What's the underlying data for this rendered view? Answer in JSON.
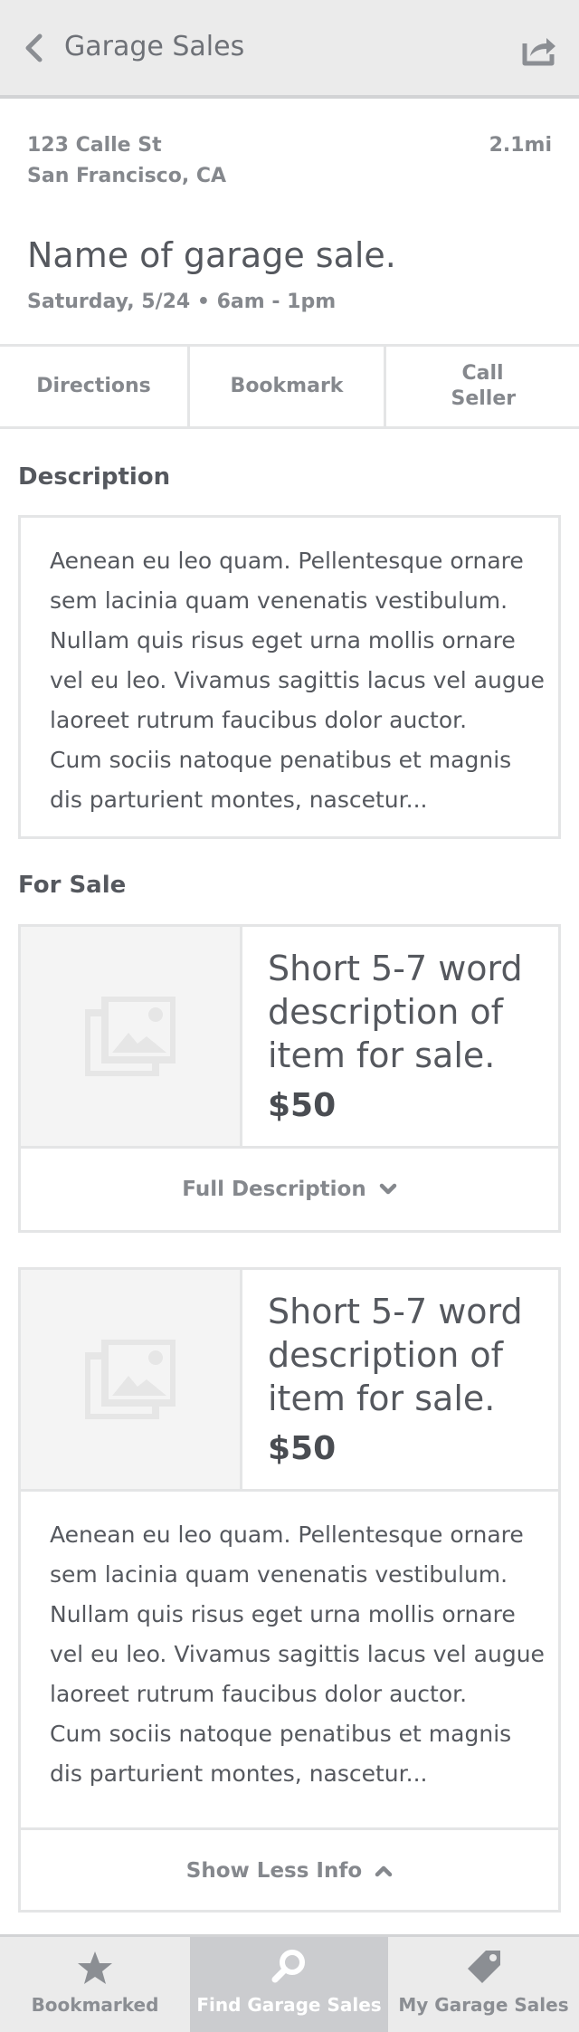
{
  "header": {
    "back_icon": "chevron-left-icon",
    "title": "Garage Sales",
    "share_icon": "share-icon"
  },
  "sale": {
    "address_line1": "123 Calle St",
    "address_line2": "San Francisco, CA",
    "distance": "2.1mi",
    "name": "Name of garage sale.",
    "date_time": "Saturday, 5/24 • 6am - 1pm"
  },
  "actions": {
    "directions": "Directions",
    "bookmark": "Bookmark",
    "call_seller": "Call Seller"
  },
  "description": {
    "heading": "Description",
    "lines": [
      "Aenean eu leo quam. Pellentesque ornare",
      "sem lacinia quam venenatis vestibulum.",
      "Nullam quis risus eget urna mollis ornare",
      "vel eu leo. Vivamus sagittis lacus vel augue",
      "laoreet rutrum faucibus dolor auctor.",
      "Cum sociis natoque penatibus et magnis",
      "dis parturient montes, nascetur..."
    ]
  },
  "for_sale": {
    "heading": "For Sale",
    "items": [
      {
        "title": "Short 5-7 word description of item for sale.",
        "price": "$50",
        "toggle_label": "Full Description",
        "toggle_icon": "chevron-down-icon"
      },
      {
        "title": "Short 5-7 word description of item for sale.",
        "price": "$50",
        "description_lines": [
          "Aenean eu leo quam. Pellentesque ornare",
          "sem lacinia quam venenatis vestibulum.",
          "Nullam quis risus eget urna mollis ornare",
          "vel eu leo. Vivamus sagittis lacus vel augue",
          "laoreet rutrum faucibus dolor auctor.",
          "Cum sociis natoque penatibus et magnis",
          "dis parturient montes, nascetur..."
        ],
        "toggle_label": "Show Less Info",
        "toggle_icon": "chevron-up-icon"
      }
    ]
  },
  "tabbar": {
    "tabs": [
      {
        "label": "Bookmarked",
        "icon": "star-icon",
        "active": false
      },
      {
        "label": "Find Garage Sales",
        "icon": "search-icon",
        "active": true
      },
      {
        "label": "My Garage Sales",
        "icon": "tag-icon",
        "active": false
      }
    ]
  },
  "colors": {
    "header_bg": "#ebebeb",
    "border": "#e4e5e6",
    "text_dark": "#55585e",
    "text_muted": "#85888d",
    "active_tab_bg": "#cbcccf"
  }
}
